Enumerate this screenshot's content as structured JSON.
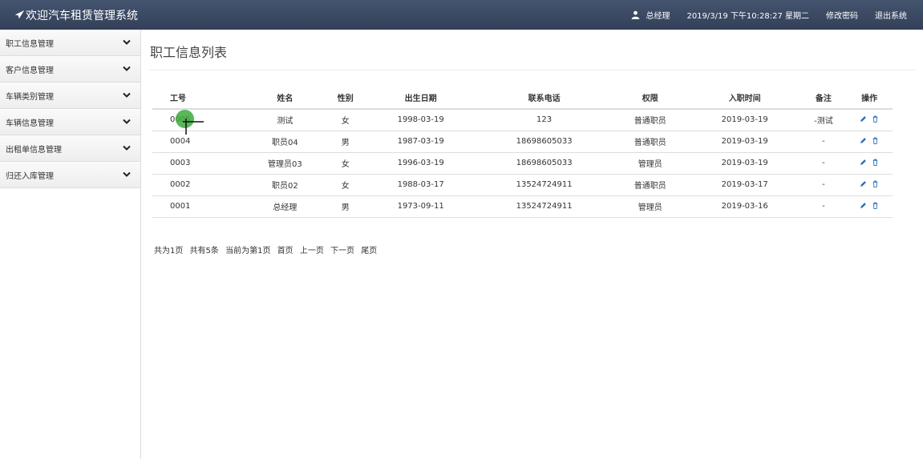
{
  "header": {
    "title": "欢迎汽车租赁管理系统",
    "user": "总经理",
    "datetime": "2019/3/19 下午10:28:27 星期二",
    "change_password": "修改密码",
    "logout": "退出系统"
  },
  "sidebar": {
    "items": [
      {
        "label": "职工信息管理"
      },
      {
        "label": "客户信息管理"
      },
      {
        "label": "车辆类别管理"
      },
      {
        "label": "车辆信息管理"
      },
      {
        "label": "出租单信息管理"
      },
      {
        "label": "归还入库管理"
      }
    ]
  },
  "main": {
    "title": "职工信息列表",
    "columns": [
      "工号",
      "姓名",
      "性别",
      "出生日期",
      "联系电话",
      "权限",
      "入职时间",
      "备注",
      "操作"
    ],
    "rows": [
      {
        "id": "0005",
        "name": "测试",
        "gender": "女",
        "birth": "1998-03-19",
        "phone": "123",
        "role": "普通职员",
        "hired": "2019-03-19",
        "note": "-测试"
      },
      {
        "id": "0004",
        "name": "职员04",
        "gender": "男",
        "birth": "1987-03-19",
        "phone": "18698605033",
        "role": "普通职员",
        "hired": "2019-03-19",
        "note": "-"
      },
      {
        "id": "0003",
        "name": "管理员03",
        "gender": "女",
        "birth": "1996-03-19",
        "phone": "18698605033",
        "role": "管理员",
        "hired": "2019-03-19",
        "note": "-"
      },
      {
        "id": "0002",
        "name": "职员02",
        "gender": "女",
        "birth": "1988-03-17",
        "phone": "13524724911",
        "role": "普通职员",
        "hired": "2019-03-17",
        "note": "-"
      },
      {
        "id": "0001",
        "name": "总经理",
        "gender": "男",
        "birth": "1973-09-11",
        "phone": "13524724911",
        "role": "管理员",
        "hired": "2019-03-16",
        "note": "-"
      }
    ]
  },
  "pager": {
    "total_pages": "共为1页",
    "total_records": "共有5条",
    "current": "当前为第1页",
    "first": "首页",
    "prev": "上一页",
    "next": "下一页",
    "last": "尾页"
  },
  "colors": {
    "navbar": "#3b4a63",
    "accent_icon": "#2a6ebb"
  },
  "icons": {
    "brand": "send-icon",
    "user": "user-icon",
    "menu": "chevron-down-icon",
    "edit": "pencil-icon",
    "delete": "trash-icon"
  }
}
